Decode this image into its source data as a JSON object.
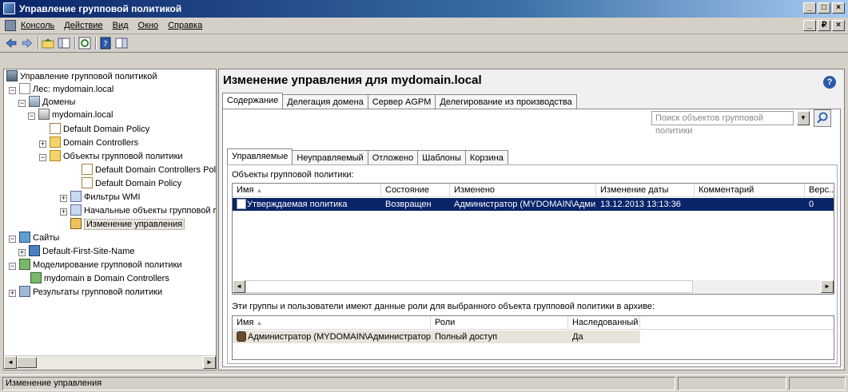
{
  "window": {
    "title": "Управление групповой политикой",
    "buttons": {
      "minimize": "_",
      "maximize": "□",
      "close": "×"
    }
  },
  "menu": {
    "items": [
      "Консоль",
      "Действие",
      "Вид",
      "Окно",
      "Справка"
    ],
    "mdi_buttons": {
      "minimize": "_",
      "restore": "₽",
      "close": "×"
    }
  },
  "tree": {
    "items": [
      {
        "label": "Управление групповой политикой",
        "icon": "console-icon"
      },
      {
        "label": "Лес: mydomain.local",
        "icon": "forest-icon"
      },
      {
        "label": "Домены",
        "icon": "domains-icon"
      },
      {
        "label": "mydomain.local",
        "icon": "domain-icon"
      },
      {
        "label": "Default Domain Policy",
        "icon": "gpo-link-icon"
      },
      {
        "label": "Domain Controllers",
        "icon": "ou-folder-icon"
      },
      {
        "label": "Объекты групповой политики",
        "icon": "folder-icon"
      },
      {
        "label": "Default Domain Controllers Policy",
        "icon": "gpo-icon"
      },
      {
        "label": "Default Domain Policy",
        "icon": "gpo-icon"
      },
      {
        "label": "Фильтры WMI",
        "icon": "wmi-folder-icon"
      },
      {
        "label": "Начальные объекты групповой пол",
        "icon": "starter-gpo-icon"
      },
      {
        "label": "Изменение управления",
        "icon": "change-control-icon"
      },
      {
        "label": "Сайты",
        "icon": "sites-icon"
      },
      {
        "label": "Default-First-Site-Name",
        "icon": "site-icon"
      },
      {
        "label": "Моделирование групповой политики",
        "icon": "modeling-icon"
      },
      {
        "label": "mydomain в Domain Controllers",
        "icon": "modeling-item-icon"
      },
      {
        "label": "Результаты групповой политики",
        "icon": "results-icon"
      }
    ],
    "expanders": {
      "plus": "+",
      "minus": "−"
    }
  },
  "main": {
    "title": "Изменение управления для mydomain.local",
    "help_icon": "?",
    "tabs": [
      "Содержание",
      "Делегация домена",
      "Сервер AGPM",
      "Делегирование из производства"
    ],
    "search": {
      "placeholder": "Поиск объектов групповой политики"
    },
    "subtabs": [
      "Управляемые",
      "Неуправляемый",
      "Отложено",
      "Шаблоны",
      "Корзина"
    ],
    "objects_label": "Объекты групповой политики:",
    "objects_table": {
      "columns": [
        "Имя",
        "Состояние",
        "Изменено",
        "Изменение даты",
        "Комментарий",
        "Верс..."
      ],
      "rows": [
        [
          "Утверждаемая политика",
          "Возвращен",
          "Администратор (MYDOMAIN\\Адми...",
          "13.12.2013 13:13:36",
          "",
          "0"
        ]
      ]
    },
    "roles_label": "Эти группы и пользователи имеют данные роли для выбранного объекта групповой политики в архиве:",
    "roles_table": {
      "columns": [
        "Имя",
        "Роли",
        "Наследованный"
      ],
      "rows": [
        [
          "Администратор (MYDOMAIN\\Администратор)",
          "Полный доступ",
          "Да"
        ]
      ]
    },
    "sort_indicator": "▲"
  },
  "status": {
    "text": "Изменение управления"
  },
  "scroll": {
    "left": "◄",
    "right": "►",
    "down": "▼"
  }
}
